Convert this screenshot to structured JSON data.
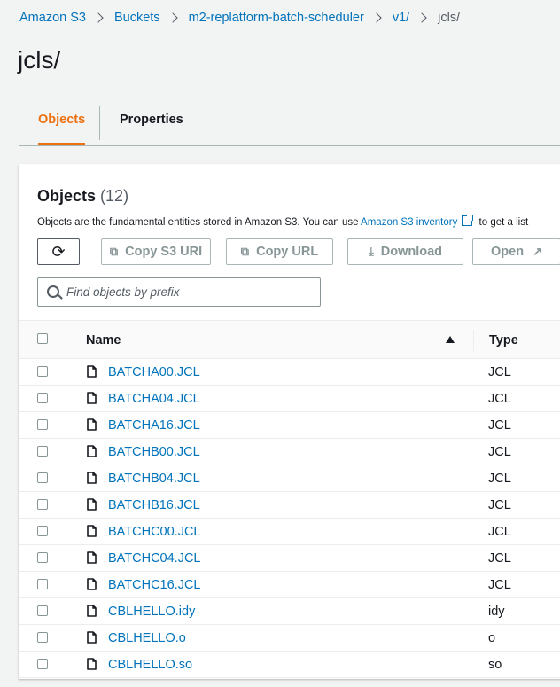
{
  "breadcrumb": {
    "items": [
      "Amazon S3",
      "Buckets",
      "m2-replatform-batch-scheduler",
      "v1/"
    ],
    "current": "jcls/"
  },
  "page": {
    "title": "jcls/"
  },
  "tabs": [
    {
      "label": "Objects",
      "active": true
    },
    {
      "label": "Properties",
      "active": false
    }
  ],
  "objects_panel": {
    "title": "Objects",
    "count": "(12)",
    "description_prefix": "Objects are the fundamental entities stored in Amazon S3. You can use ",
    "inventory_link": "Amazon S3 inventory",
    "description_suffix": " to get a list",
    "actions": {
      "refresh_icon": "refresh-icon",
      "copy_s3_uri": "Copy S3 URI",
      "copy_url": "Copy URL",
      "download": "Download",
      "open": "Open"
    },
    "search": {
      "placeholder": "Find objects by prefix",
      "value": ""
    },
    "columns": {
      "name": "Name",
      "type": "Type"
    },
    "rows": [
      {
        "name": "BATCHA00.JCL",
        "type": "JCL"
      },
      {
        "name": "BATCHA04.JCL",
        "type": "JCL"
      },
      {
        "name": "BATCHA16.JCL",
        "type": "JCL"
      },
      {
        "name": "BATCHB00.JCL",
        "type": "JCL"
      },
      {
        "name": "BATCHB04.JCL",
        "type": "JCL"
      },
      {
        "name": "BATCHB16.JCL",
        "type": "JCL"
      },
      {
        "name": "BATCHC00.JCL",
        "type": "JCL"
      },
      {
        "name": "BATCHC04.JCL",
        "type": "JCL"
      },
      {
        "name": "BATCHC16.JCL",
        "type": "JCL"
      },
      {
        "name": "CBLHELLO.idy",
        "type": "idy"
      },
      {
        "name": "CBLHELLO.o",
        "type": "o"
      },
      {
        "name": "CBLHELLO.so",
        "type": "so"
      }
    ]
  },
  "colors": {
    "link": "#0073bb",
    "accent": "#ec7211",
    "text": "#16191f",
    "muted": "#879596",
    "background": "#f2f3f3"
  }
}
